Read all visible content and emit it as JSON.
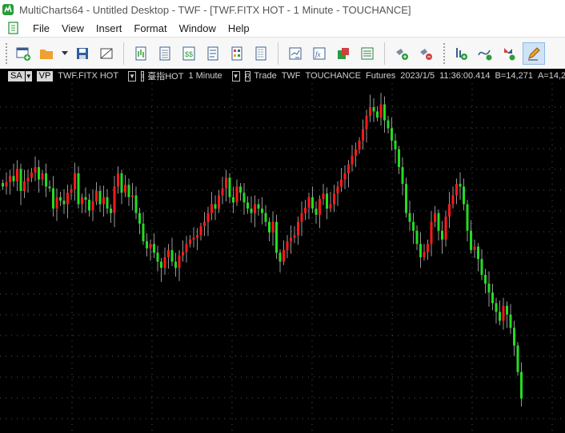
{
  "window": {
    "title": "MultiCharts64 - Untitled Desktop - TWF - [TWF.FITX HOT - 1 Minute - TOUCHANCE]"
  },
  "menu": {
    "items": [
      "File",
      "View",
      "Insert",
      "Format",
      "Window",
      "Help"
    ]
  },
  "toolbar": {
    "icons": [
      "new-workspace-icon",
      "open-folder-icon",
      "save-icon",
      "close-workspace-icon",
      "new-chart-icon",
      "new-scanner-icon",
      "new-dom-icon",
      "new-report-icon",
      "new-grid-icon",
      "new-list-icon",
      "insert-study-icon",
      "insert-function-icon",
      "insert-signal-icon",
      "insert-portfolio-icon",
      "connect-icon",
      "disconnect-icon",
      "add-indicator-icon",
      "add-curve-icon",
      "add-symbol-icon",
      "drawing-pencil-icon"
    ],
    "accent": "#f0a030"
  },
  "status": {
    "sa": "SA",
    "vp": "VP",
    "symbol": "TWF.FITX HOT",
    "i_box": "I",
    "name": "臺指HOT",
    "interval": "1 Minute",
    "r_box": "R",
    "mode": "Trade",
    "exchange": "TWF",
    "feed": "TOUCHANCE",
    "category": "Futures",
    "date": "2023/1/5",
    "time": "11:36:00.414",
    "bid": "B=14,271",
    "ask": "A=14,2"
  },
  "colors": {
    "up": "#ff1a1a",
    "down": "#22dd22",
    "wick": "#d8d8d8",
    "grid": "#555555",
    "bg": "#000000"
  },
  "chart_data": {
    "type": "candlestick",
    "closes": [
      330,
      335,
      342,
      336,
      350,
      325,
      336,
      340,
      346,
      352,
      338,
      345,
      330,
      328,
      305,
      318,
      314,
      310,
      323,
      327,
      345,
      310,
      318,
      315,
      303,
      313,
      325,
      310,
      318,
      305,
      300,
      330,
      345,
      323,
      332,
      318,
      320,
      300,
      288,
      268,
      260,
      265,
      255,
      245,
      238,
      250,
      258,
      245,
      238,
      252,
      256,
      265,
      270,
      272,
      275,
      285,
      290,
      300,
      310,
      305,
      320,
      328,
      340,
      318,
      312,
      330,
      323,
      312,
      305,
      300,
      310,
      305,
      300,
      290,
      278,
      290,
      255,
      245,
      258,
      268,
      272,
      275,
      290,
      300,
      306,
      318,
      305,
      298,
      316,
      322,
      305,
      310,
      322,
      330,
      338,
      345,
      355,
      365,
      372,
      382,
      395,
      410,
      420,
      415,
      408,
      423,
      405,
      396,
      382,
      372,
      352,
      333,
      300,
      290,
      280,
      265,
      250,
      256,
      265,
      290,
      300,
      280,
      270,
      296,
      310,
      320,
      333,
      330,
      310,
      280,
      258,
      262,
      248,
      230,
      220,
      210,
      198,
      188,
      178,
      195,
      185,
      170,
      150,
      120,
      90
    ]
  }
}
